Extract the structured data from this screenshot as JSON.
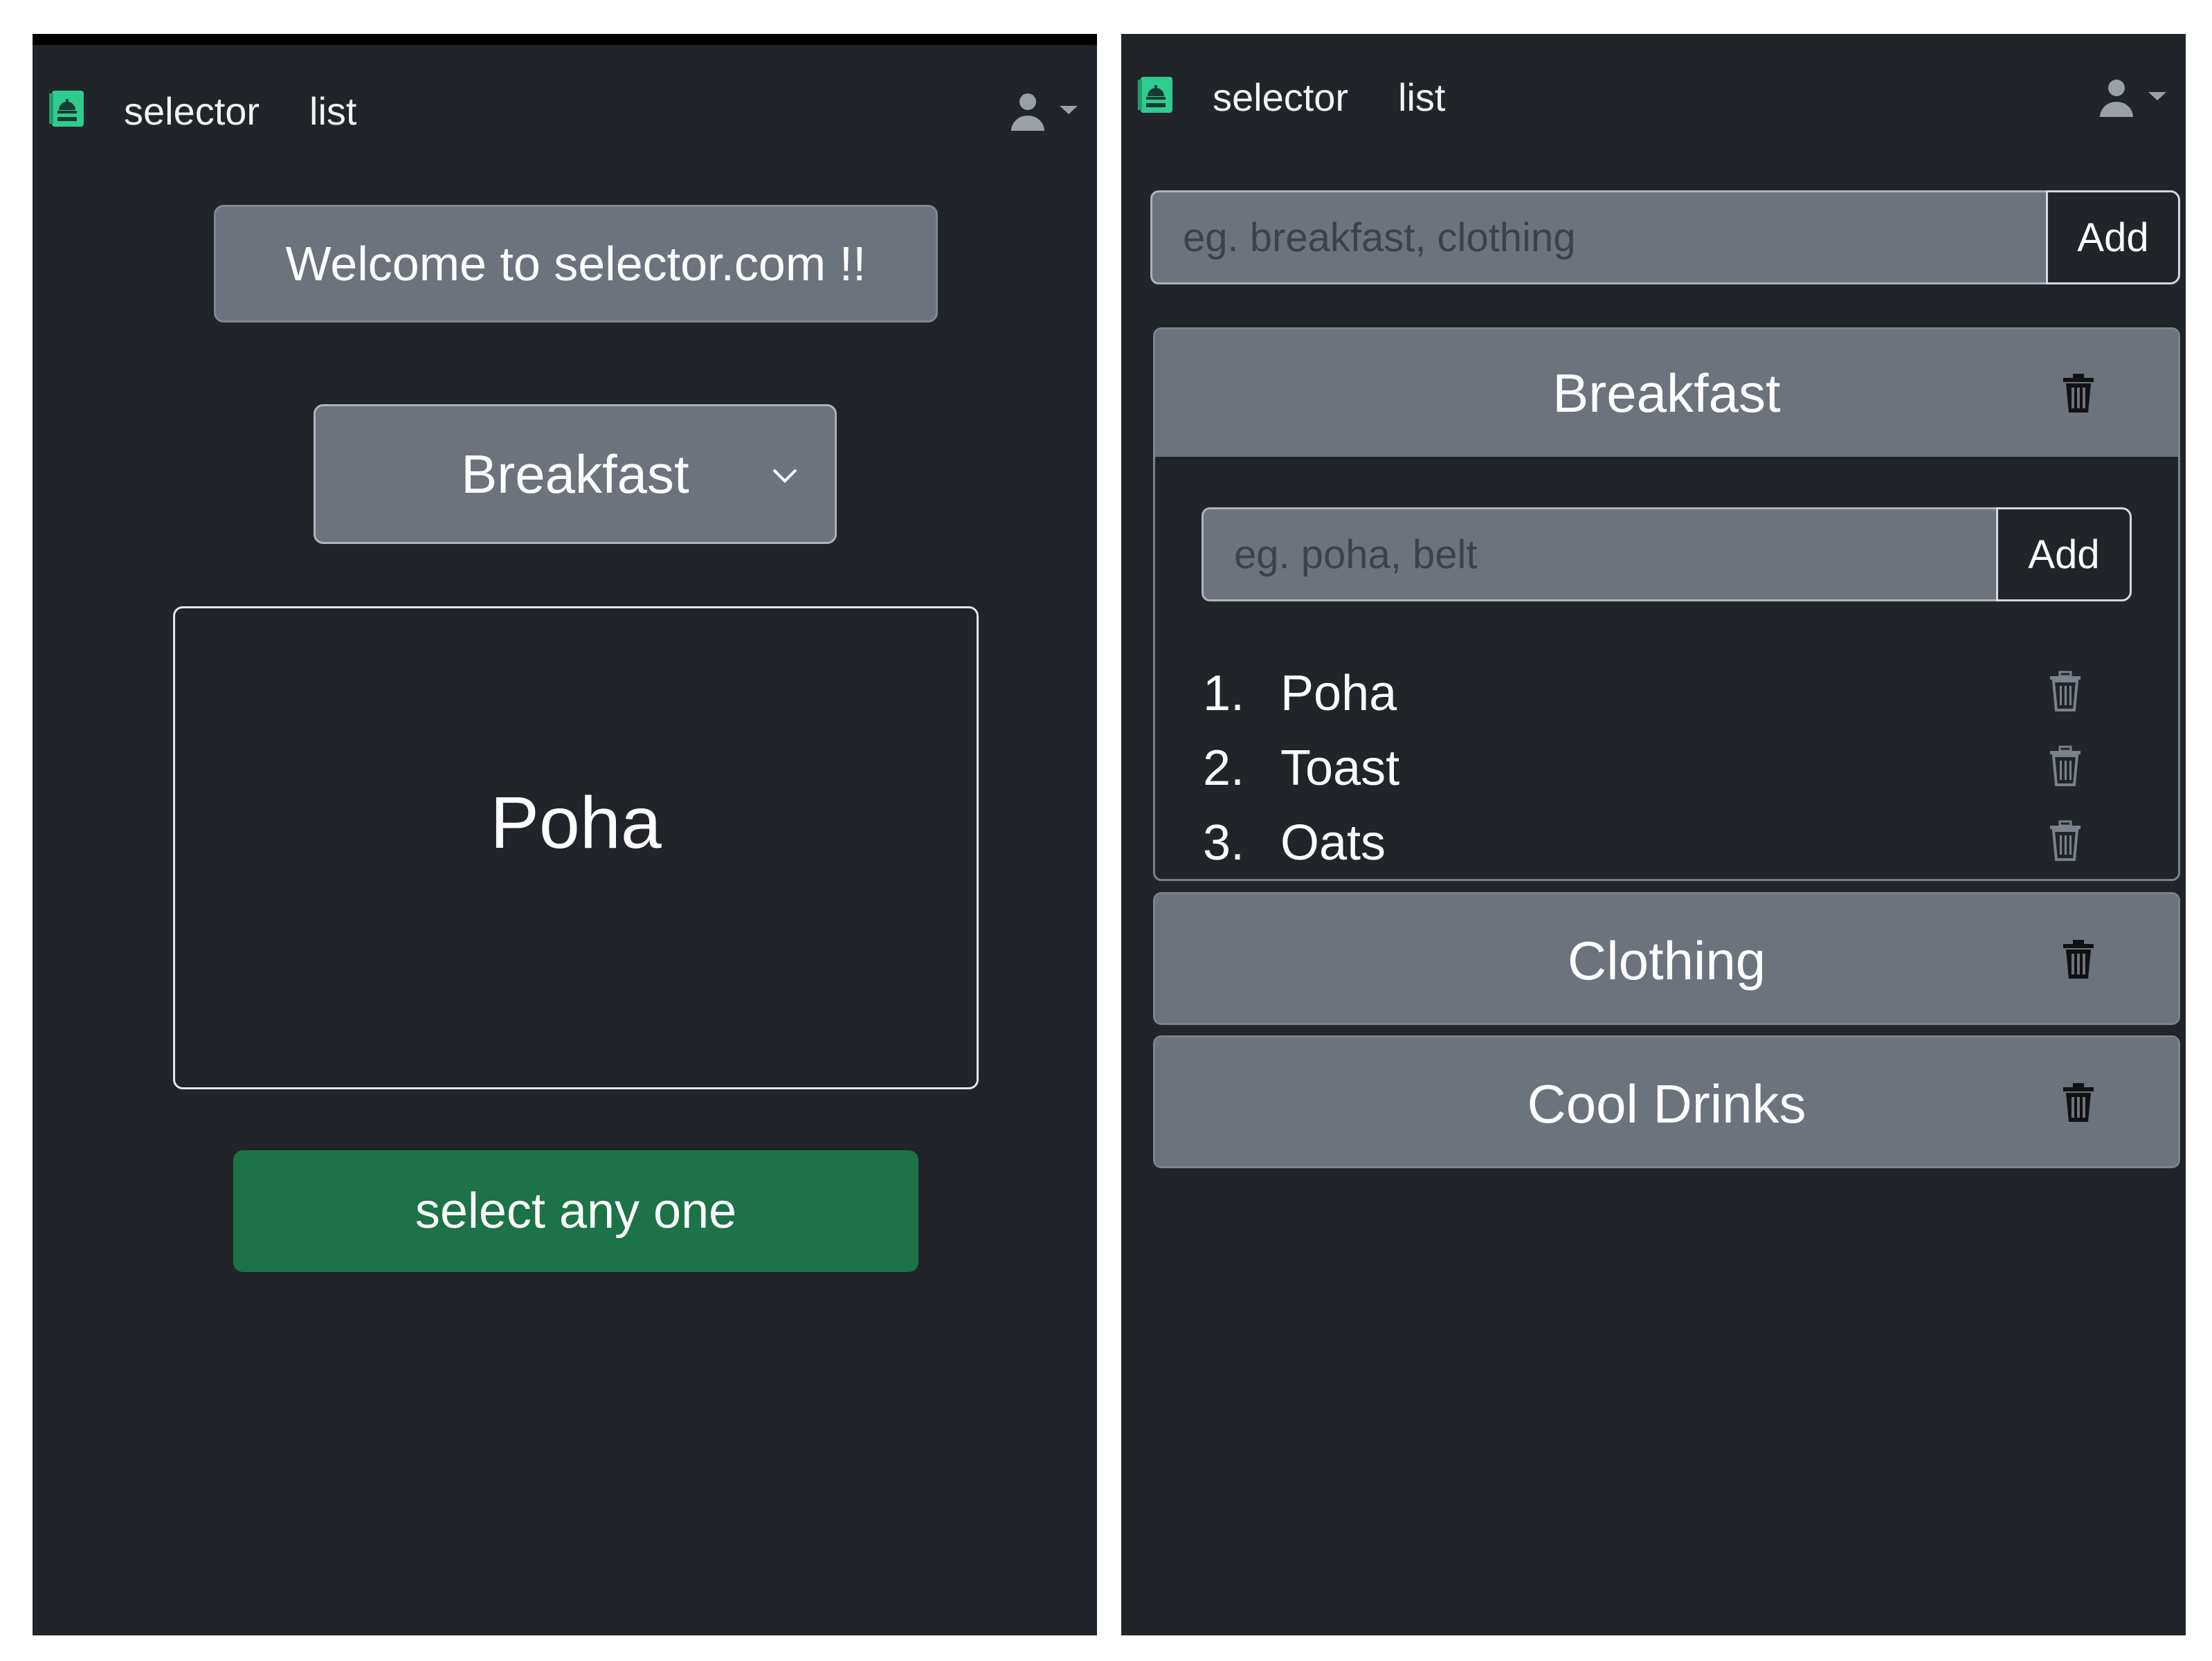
{
  "left_screen": {
    "nav": {
      "brand": "selector",
      "link": "list",
      "logo_icon": "menu-book-icon",
      "user_icon": "user-icon"
    },
    "welcome_text": "Welcome to selector.com !!",
    "category_select": {
      "selected": "Breakfast"
    },
    "result": "Poha",
    "select_button": "select any one"
  },
  "right_screen": {
    "nav": {
      "brand": "selector",
      "link": "list",
      "logo_icon": "menu-book-icon",
      "user_icon": "user-icon"
    },
    "category_input": {
      "placeholder": "eg. breakfast, clothing",
      "add_label": "Add"
    },
    "categories": [
      {
        "name": "Breakfast",
        "expanded": true,
        "item_input": {
          "placeholder": "eg. poha, belt",
          "add_label": "Add"
        },
        "items": [
          {
            "num": "1.",
            "name": "Poha"
          },
          {
            "num": "2.",
            "name": "Toast"
          },
          {
            "num": "3.",
            "name": "Oats"
          }
        ]
      },
      {
        "name": "Clothing",
        "expanded": false
      },
      {
        "name": "Cool Drinks",
        "expanded": false
      }
    ]
  },
  "colors": {
    "background": "#212429",
    "muted_panel": "#6c737d",
    "success_button": "#1b7346",
    "logo_accent": "#2ecc8f"
  }
}
